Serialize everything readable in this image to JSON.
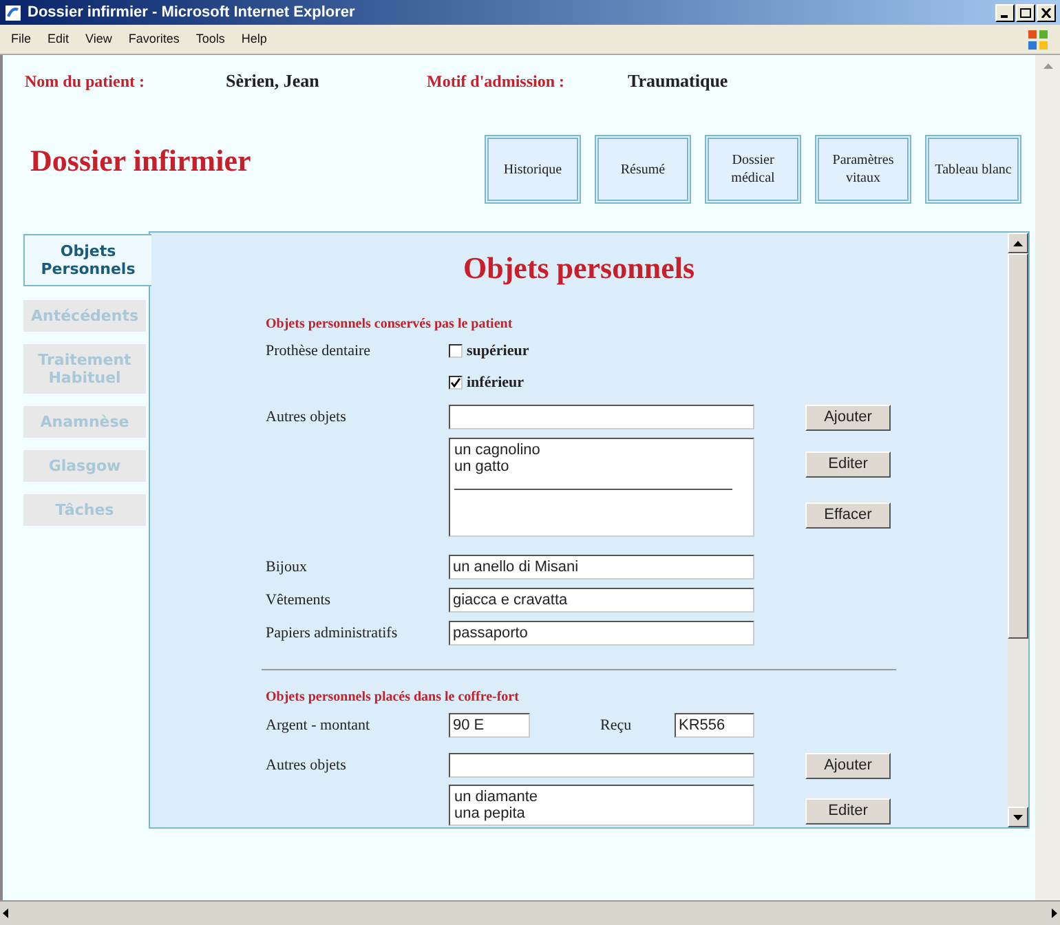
{
  "window": {
    "title": "Dossier infirmier - Microsoft Internet Explorer"
  },
  "menu": [
    "File",
    "Edit",
    "View",
    "Favorites",
    "Tools",
    "Help"
  ],
  "patient": {
    "name_label": "Nom du patient :",
    "name": "Sèrien, Jean",
    "reason_label": "Motif d'admission :",
    "reason": "Traumatique"
  },
  "app_title": "Dossier infirmier",
  "nav_buttons": [
    "Historique",
    "Résumé",
    "Dossier médical",
    "Paramètres vitaux",
    "Tableau blanc"
  ],
  "tabs": [
    {
      "label": "Objets Personnels",
      "selected": true
    },
    {
      "label": "Antécédents",
      "selected": false
    },
    {
      "label": "Traitement Habituel",
      "selected": false
    },
    {
      "label": "Anamnèse",
      "selected": false
    },
    {
      "label": "Glasgow",
      "selected": false
    },
    {
      "label": "Tâches",
      "selected": false
    }
  ],
  "panel_title": "Objets personnels",
  "section1": {
    "heading": "Objets personnels conservés pas le patient",
    "denture_label": "Prothèse dentaire",
    "denture_options": [
      {
        "label": "supérieur",
        "checked": false
      },
      {
        "label": "inférieur",
        "checked": true
      }
    ],
    "other_label": "Autres objets",
    "other_list": [
      "un cagnolino",
      "un gatto"
    ],
    "buttons": [
      "Ajouter",
      "Editer",
      "Effacer"
    ],
    "fields": [
      {
        "label": "Bijoux",
        "value": "un anello di Misani"
      },
      {
        "label": "Vêtements",
        "value": "giacca e cravatta"
      },
      {
        "label": "Papiers administratifs",
        "value": "passaporto"
      }
    ]
  },
  "section2": {
    "heading": "Objets personnels placés dans le coffre-fort",
    "money_label": "Argent - montant",
    "money": "90 E",
    "receipt_label": "Reçu",
    "receipt": "KR556",
    "other_label": "Autres objets",
    "other_list": [
      "un diamante",
      "una pepita"
    ],
    "buttons": [
      "Ajouter",
      "Editer"
    ]
  }
}
